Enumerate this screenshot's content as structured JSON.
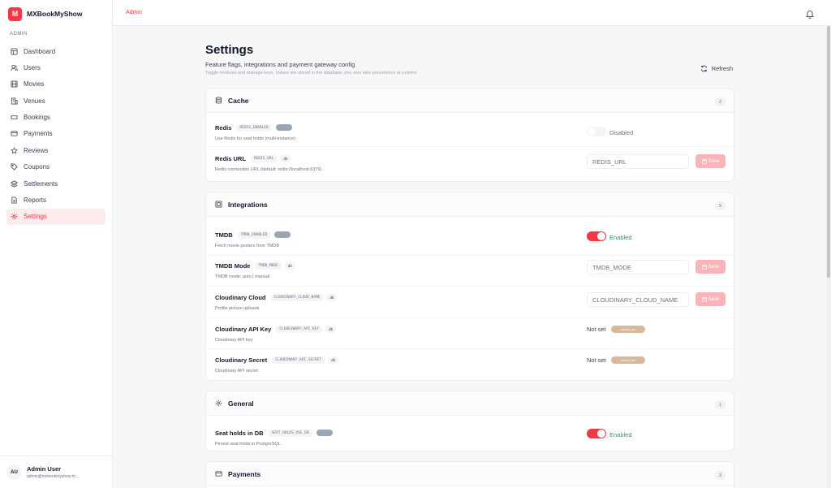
{
  "brand": {
    "logo_letter": "M",
    "name": "MXBookMyShow",
    "accent": "#ef3a45"
  },
  "sidebar": {
    "section": "ADMIN",
    "items": [
      {
        "label": "Dashboard",
        "icon": "dashboard-icon"
      },
      {
        "label": "Users",
        "icon": "users-icon"
      },
      {
        "label": "Movies",
        "icon": "film-icon"
      },
      {
        "label": "Venues",
        "icon": "building-icon"
      },
      {
        "label": "Bookings",
        "icon": "ticket-icon"
      },
      {
        "label": "Payments",
        "icon": "credit-card-icon"
      },
      {
        "label": "Reviews",
        "icon": "star-icon"
      },
      {
        "label": "Coupons",
        "icon": "tag-icon"
      },
      {
        "label": "Settlements",
        "icon": "layers-icon"
      },
      {
        "label": "Reports",
        "icon": "document-icon"
      },
      {
        "label": "Settings",
        "icon": "gear-icon",
        "active": true
      }
    ],
    "user": {
      "initials": "AU",
      "name": "Admin User",
      "email": "admin@mxbookmyshow.m..."
    }
  },
  "topbar": {
    "crumb": "Admin",
    "bell_icon": "bell-icon"
  },
  "page": {
    "title": "Settings",
    "subtitle": "Feature flags, integrations and payment gateway config",
    "hint": "Toggle modules and manage keys. Values are stored in the database; env vars take precedence at runtime.",
    "refresh_label": "Refresh"
  },
  "sections": {
    "cache": {
      "title": "Cache",
      "count": "2",
      "redis": {
        "name": "Redis",
        "key": "REDIS_ENABLED",
        "desc": "Use Redis for seat holds (multi-instance)",
        "status": "Disabled"
      },
      "redis_url": {
        "name": "Redis URL",
        "key": "REDIS_URL",
        "source": "db",
        "desc": "Redis connection URL (default: redis://localhost:6379)",
        "placeholder": "REDIS_URL",
        "save_label": "Save"
      }
    },
    "integrations": {
      "title": "Integrations",
      "count": "5",
      "tmdb": {
        "name": "TMDB",
        "key": "TMDB_ENABLED",
        "desc": "Fetch movie posters from TMDB",
        "status": "Enabled"
      },
      "tmdb_mode": {
        "name": "TMDB Mode",
        "key": "TMDB_MODE",
        "source": "db",
        "desc": "TMDB mode: auto | manual",
        "placeholder": "TMDB_MODE",
        "save_label": "Save"
      },
      "cloud_name": {
        "name": "Cloudinary Cloud",
        "key": "CLOUDINARY_CLOUD_NAME",
        "source": "db",
        "desc": "Profile picture uploads",
        "placeholder": "CLOUDINARY_CLOUD_NAME",
        "save_label": "Save"
      },
      "api_key": {
        "name": "Cloudinary API Key",
        "key": "CLOUDINARY_API_KEY",
        "source": "db",
        "desc": "Cloudinary API key",
        "value": "Not set",
        "badge": "secret_set"
      },
      "api_secret": {
        "name": "Cloudinary Secret",
        "key": "CLOUDINARY_API_SECRET",
        "source": "db",
        "desc": "Cloudinary API secret",
        "value": "Not set",
        "badge": "secret_set"
      }
    },
    "general": {
      "title": "General",
      "count": "1",
      "seat_holds": {
        "name": "Seat holds in DB",
        "key": "SEAT_HOLDS_USE_DB",
        "desc": "Persist seat holds in PostgreSQL",
        "status": "Enabled"
      }
    },
    "payments": {
      "title": "Payments",
      "count": "3"
    }
  },
  "colors": {
    "enabled": "#22a06b",
    "toggle_on": "#ef3a45",
    "save_disabled": "#f9b4b9",
    "secret_badge": "#d7b89a"
  }
}
